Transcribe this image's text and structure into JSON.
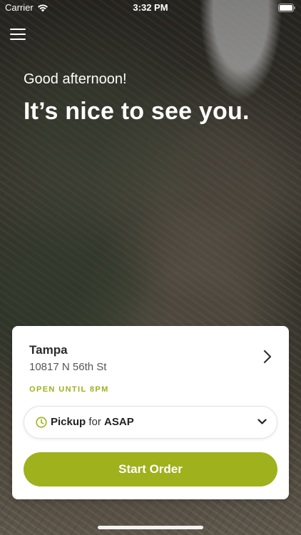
{
  "status_bar": {
    "carrier": "Carrier",
    "time": "3:32 PM",
    "icons": [
      "wifi-icon",
      "battery-icon"
    ]
  },
  "menu": {
    "icon": "hamburger-menu-icon"
  },
  "greeting": {
    "salutation": "Good afternoon!",
    "headline": "It’s nice to see you."
  },
  "location_card": {
    "name": "Tampa",
    "address": "10817 N 56th St",
    "hours": "OPEN UNTIL 8PM",
    "order_type": "Pickup",
    "order_for": "for",
    "order_time": "ASAP",
    "start_label": "Start Order"
  },
  "colors": {
    "accent": "#9fb11c",
    "card_bg": "#ffffff",
    "text_dark": "#2a2a2a"
  }
}
